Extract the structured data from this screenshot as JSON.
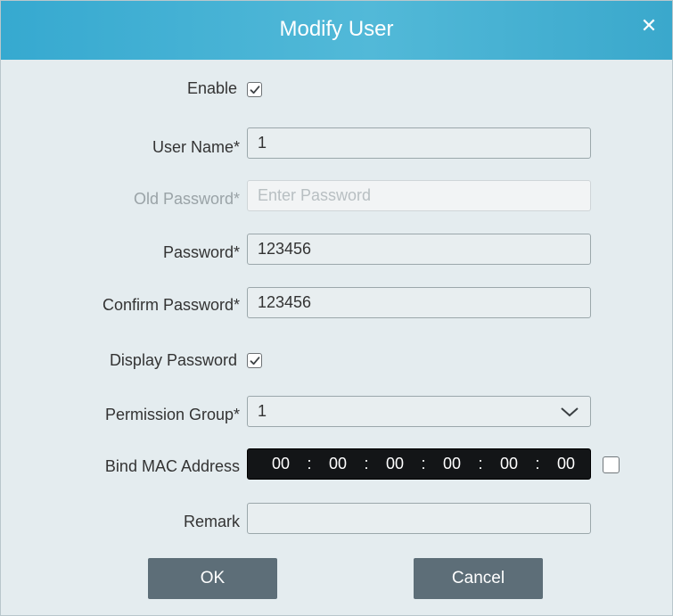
{
  "dialog": {
    "title": "Modify User",
    "close_glyph": "✕"
  },
  "form": {
    "enable": {
      "label": "Enable",
      "checked": true
    },
    "user_name": {
      "label": "User Name*",
      "value": "1"
    },
    "old_password": {
      "label": "Old Password*",
      "placeholder": "Enter Password",
      "disabled": true
    },
    "password": {
      "label": "Password*",
      "value": "123456"
    },
    "confirm_password": {
      "label": "Confirm Password*",
      "value": "123456"
    },
    "display_password": {
      "label": "Display Password",
      "checked": true
    },
    "permission_group": {
      "label": "Permission Group*",
      "value": "1",
      "icon": "chevron-down-icon"
    },
    "bind_mac": {
      "label": "Bind MAC Address",
      "octets": [
        "00",
        "00",
        "00",
        "00",
        "00",
        "00"
      ],
      "separator": ":",
      "checked": false
    },
    "remark": {
      "label": "Remark",
      "value": ""
    }
  },
  "buttons": {
    "ok": "OK",
    "cancel": "Cancel"
  },
  "colors": {
    "title_bar": "#36a9d0",
    "background": "#e4ecef",
    "button": "#5d6e78",
    "mac_field": "#131517"
  }
}
